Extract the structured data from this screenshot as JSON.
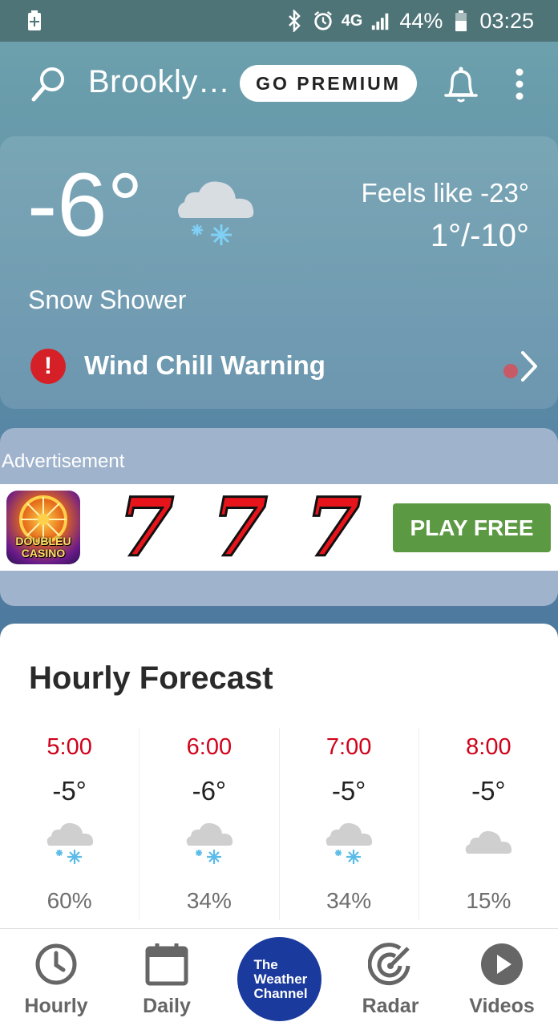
{
  "status_bar": {
    "battery_pct": "44%",
    "time": "03:25",
    "network": "4G"
  },
  "header": {
    "location": "Brookly…",
    "premium_label": "GO PREMIUM"
  },
  "current": {
    "temp": "-6°",
    "feels_like": "Feels like -23°",
    "hi_lo": "1°/-10°",
    "condition": "Snow Shower",
    "alert": "Wind Chill Warning",
    "alert_icon": "!"
  },
  "ad": {
    "label": "Advertisement",
    "brand_line1": "DOUBLEU",
    "brand_line2": "CASINO",
    "sevens": [
      "7",
      "7",
      "7"
    ],
    "cta": "PLAY FREE"
  },
  "hourly": {
    "title": "Hourly Forecast",
    "items": [
      {
        "time": "5:00",
        "temp": "-5°",
        "icon": "snow-cloud-icon",
        "precip": "60%"
      },
      {
        "time": "6:00",
        "temp": "-6°",
        "icon": "snow-cloud-icon",
        "precip": "34%"
      },
      {
        "time": "7:00",
        "temp": "-5°",
        "icon": "snow-cloud-icon",
        "precip": "34%"
      },
      {
        "time": "8:00",
        "temp": "-5°",
        "icon": "cloud-icon",
        "precip": "15%"
      }
    ]
  },
  "nav": {
    "hourly": "Hourly",
    "daily": "Daily",
    "logo": "The\nWeather\nChannel",
    "radar": "Radar",
    "videos": "Videos"
  },
  "colors": {
    "hour_time": "#d0021b",
    "alert": "#d62027",
    "logo_bg": "#1a3a9e",
    "cta_bg": "#5b9a42"
  }
}
